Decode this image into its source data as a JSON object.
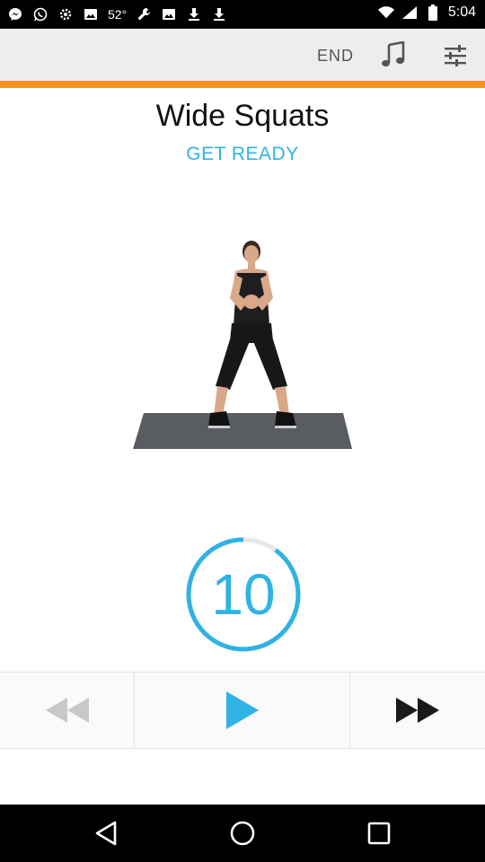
{
  "status_bar": {
    "temperature": "52°",
    "time": "5:04",
    "icons": [
      "messenger-icon",
      "whatsapp-icon",
      "settings-icon",
      "image-icon",
      "wrench-icon",
      "image-icon",
      "download-icon",
      "download-icon",
      "wifi-icon",
      "signal-icon",
      "battery-icon"
    ]
  },
  "toolbar": {
    "end_label": "END",
    "music_icon": "music-note-icon",
    "settings_icon": "tune-sliders-icon"
  },
  "exercise": {
    "title": "Wide Squats",
    "status": "GET READY"
  },
  "timer": {
    "value": "10",
    "progress_fraction": 0.9,
    "color": "#2fb3e4"
  },
  "controls": {
    "rewind_icon": "rewind-icon",
    "play_icon": "play-icon",
    "forward_icon": "fast-forward-icon"
  },
  "nav": {
    "back_icon": "back-icon",
    "home_icon": "home-icon",
    "recents_icon": "recents-icon"
  },
  "colors": {
    "accent": "#2fb3e4",
    "orange": "#f7901e"
  }
}
